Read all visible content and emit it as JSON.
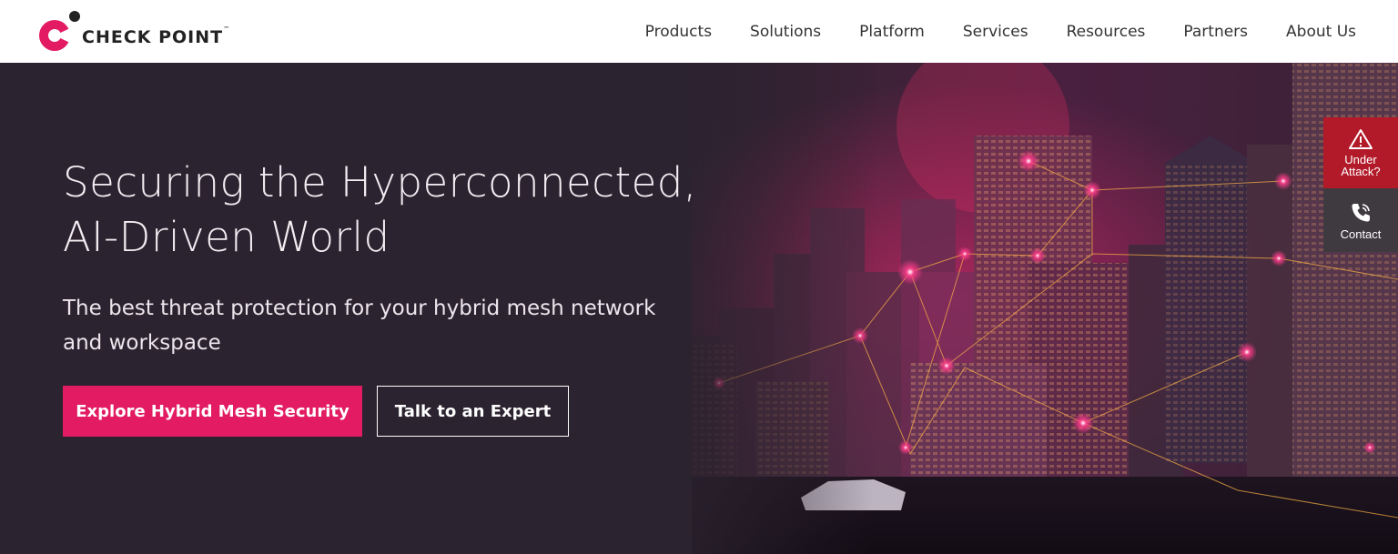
{
  "brand": {
    "name": "CHECK POINT",
    "trademark": "™",
    "logo_color": "#e21b62"
  },
  "nav": {
    "items": [
      {
        "label": "Products"
      },
      {
        "label": "Solutions"
      },
      {
        "label": "Platform"
      },
      {
        "label": "Services"
      },
      {
        "label": "Resources"
      },
      {
        "label": "Partners"
      },
      {
        "label": "About Us"
      }
    ]
  },
  "hero": {
    "headline_line1": "Securing the Hyperconnected,",
    "headline_line2": "AI-Driven World",
    "subheadline": "The best threat protection for your hybrid mesh network and workspace",
    "primary_cta": "Explore Hybrid Mesh Security",
    "secondary_cta": "Talk to an Expert",
    "background_image": "night-city-skyline-network"
  },
  "side_widgets": {
    "under_attack_label": "Under Attack?",
    "under_attack_icon": "warning-triangle-icon",
    "contact_label": "Contact",
    "contact_icon": "phone-icon"
  },
  "colors": {
    "accent": "#e21b62",
    "hero_bg": "#2c2330",
    "alert_red": "#b21a2a",
    "contact_bg": "#3f3a40"
  }
}
